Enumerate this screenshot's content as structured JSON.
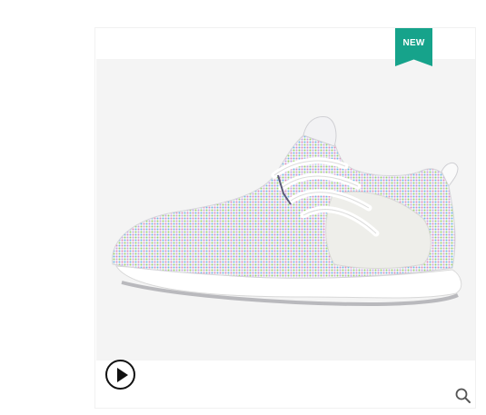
{
  "badge": {
    "label": "NEW",
    "color": "#16a38b"
  },
  "product_image": {
    "alt": ""
  },
  "controls": {
    "play_icon": "play-icon",
    "zoom_icon": "magnifier-icon"
  }
}
